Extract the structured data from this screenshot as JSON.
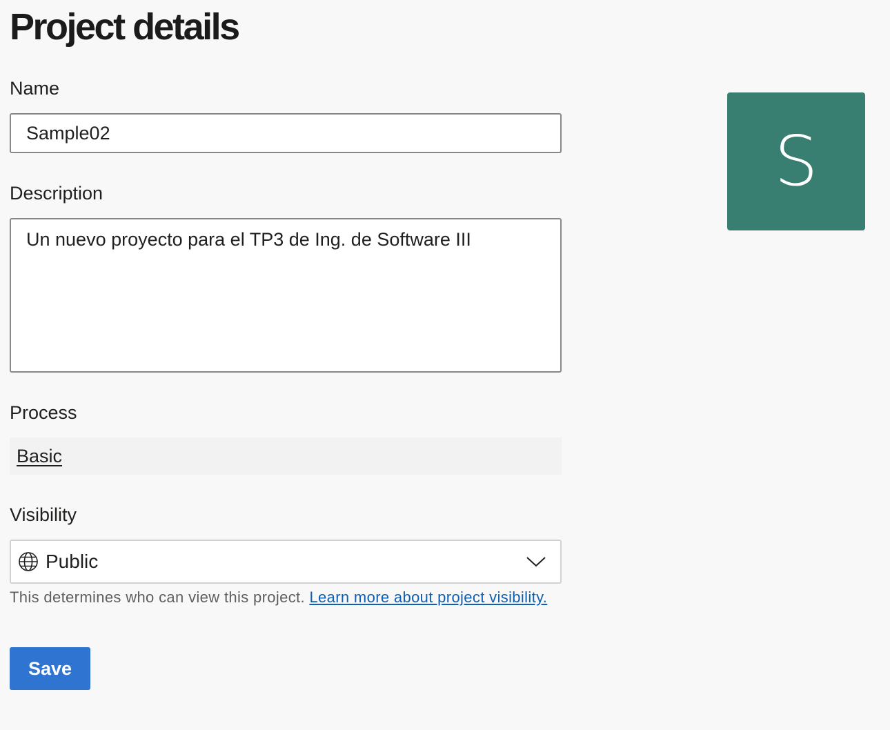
{
  "page": {
    "title": "Project details"
  },
  "fields": {
    "name": {
      "label": "Name",
      "value": "Sample02"
    },
    "description": {
      "label": "Description",
      "value": "Un nuevo proyecto para el TP3 de Ing. de Software III"
    },
    "process": {
      "label": "Process",
      "value": "Basic"
    },
    "visibility": {
      "label": "Visibility",
      "selected": "Public",
      "selected_icon": "globe-icon",
      "help_text": "This determines who can view this project.",
      "help_link": "Learn more about project visibility."
    }
  },
  "actions": {
    "save_label": "Save"
  },
  "avatar": {
    "letter": "S",
    "color": "#387f71"
  },
  "colors": {
    "primary_button": "#2e74d0",
    "link": "#0f5fb3"
  }
}
